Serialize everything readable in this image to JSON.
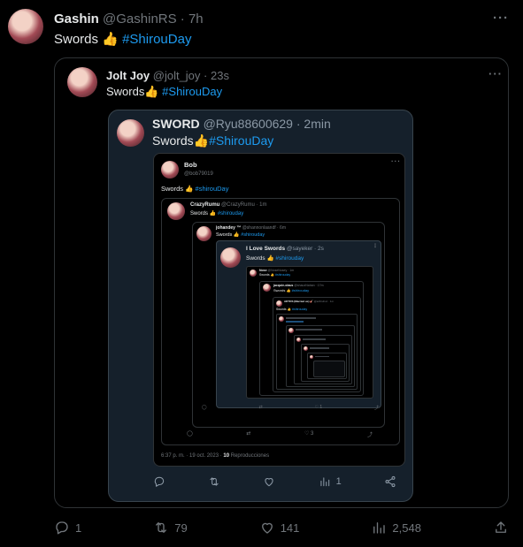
{
  "main_tweet": {
    "name": "Gashin",
    "handle": "@GashinRS",
    "time": "· 7h",
    "text": "Swords",
    "emoji": "👍",
    "hashtag": "#ShirouDay",
    "actions": {
      "reply": "1",
      "retweet": "79",
      "like": "141",
      "views": "2,548"
    }
  },
  "quote1": {
    "name": "Jolt Joy",
    "handle": "@jolt_joy",
    "time": "· 23s",
    "text": "Swords",
    "emoji": "👍",
    "hashtag": "#ShirouDay"
  },
  "quote2": {
    "name": "SWORD",
    "handle": "@Ryu88600629",
    "time": "· 2min",
    "text": "Swords",
    "emoji": "👍",
    "hashtag": "#ShirouDay",
    "actions": {
      "views": "1"
    }
  },
  "quote3": {
    "name": "Bob",
    "handle": "@bob79019",
    "text": "Swords",
    "emoji": "👍",
    "hashtag": "#shirouDay",
    "footer": "6:37 p. m. · 19 oct. 2023 ·",
    "footer_count": "10",
    "footer_label": "Reproducciones"
  },
  "quote4": {
    "name": "CrazyRumu",
    "handle": "@CrazyRumu · 1m",
    "text": "Swords",
    "emoji": "👍",
    "hashtag": "#shirouday",
    "actions": {
      "like": "3"
    }
  },
  "quote5": {
    "name": "johandey ™",
    "handle": "@shannonlaandf · 6m",
    "text": "Swords",
    "emoji": "👍",
    "hashtag": "#shirouday",
    "actions": {
      "like": "1"
    }
  },
  "quote6": {
    "name": "I Love Swords",
    "handle": "@sayeker · 2s",
    "text": "Swords",
    "emoji": "👍",
    "hashtag": "#shirouday"
  },
  "quote7": {
    "name": "Nose",
    "handle": "@NoseNosey · 1m",
    "text": "Swords",
    "emoji": "👍",
    "hashtag": "#shirouday"
  },
  "quote8": {
    "name": "jacquie-olaus",
    "handle": "@shauxNahan · 17m",
    "text": "Swords",
    "emoji": "👍",
    "hashtag": "#shirouday"
  },
  "quote9": {
    "name": "ARTOS (Married us) 🎸",
    "handle": "@arthiuhuz · 1m",
    "text": "Swords",
    "emoji": "👍",
    "hashtag": "#shirouday"
  }
}
